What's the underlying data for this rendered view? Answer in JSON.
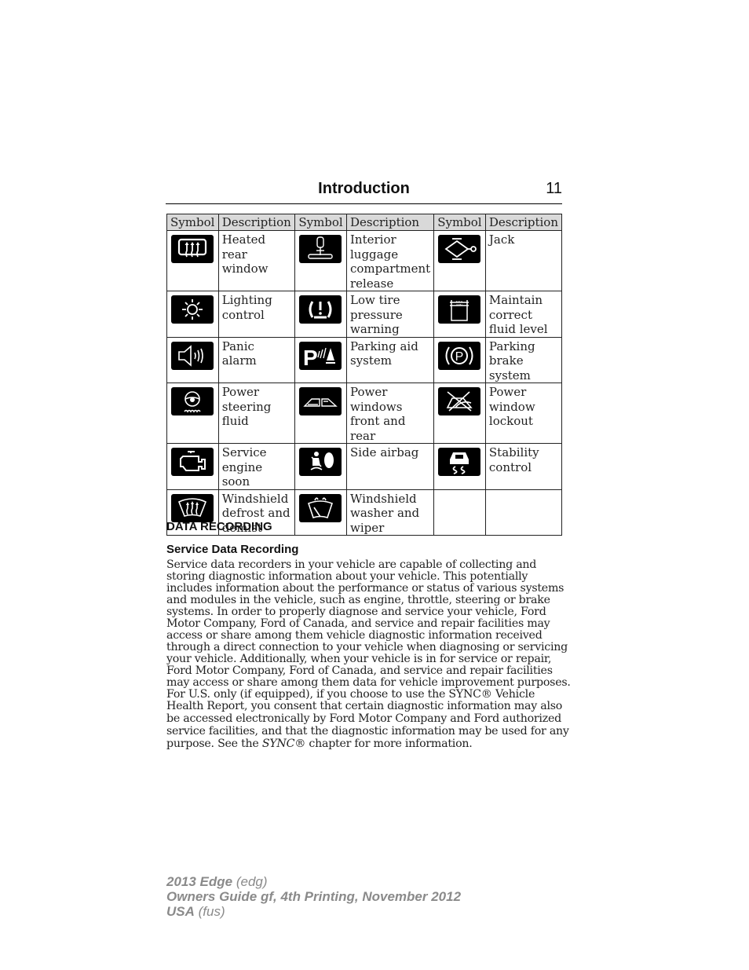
{
  "header": {
    "title": "Introduction",
    "page_number": "11"
  },
  "symbol_table": {
    "columns": [
      "Symbol",
      "Description",
      "Symbol",
      "Description",
      "Symbol",
      "Description"
    ],
    "rows": [
      [
        {
          "icon": "heated-rear-window-icon",
          "description": "Heated rear window"
        },
        {
          "icon": "interior-luggage-release-icon",
          "description": "Interior luggage compartment release"
        },
        {
          "icon": "jack-icon",
          "description": "Jack"
        }
      ],
      [
        {
          "icon": "lighting-control-icon",
          "description": "Lighting control"
        },
        {
          "icon": "low-tire-pressure-icon",
          "description": "Low tire pressure warning"
        },
        {
          "icon": "fluid-level-icon",
          "description": "Maintain correct fluid level"
        }
      ],
      [
        {
          "icon": "panic-alarm-icon",
          "description": "Panic alarm"
        },
        {
          "icon": "parking-aid-icon",
          "description": "Parking aid system"
        },
        {
          "icon": "parking-brake-icon",
          "description": "Parking brake system"
        }
      ],
      [
        {
          "icon": "power-steering-fluid-icon",
          "description": "Power steering fluid"
        },
        {
          "icon": "power-windows-icon",
          "description": "Power windows front and rear"
        },
        {
          "icon": "window-lockout-icon",
          "description": "Power window lockout"
        }
      ],
      [
        {
          "icon": "service-engine-icon",
          "description": "Service engine soon"
        },
        {
          "icon": "side-airbag-icon",
          "description": "Side airbag"
        },
        {
          "icon": "stability-control-icon",
          "description": "Stability control"
        }
      ],
      [
        {
          "icon": "windshield-defrost-icon",
          "description": "Windshield defrost and demist"
        },
        {
          "icon": "windshield-washer-icon",
          "description": "Windshield washer and wiper"
        },
        {
          "icon": "",
          "description": ""
        }
      ]
    ],
    "fluid_icon_labels": {
      "max": "MAX",
      "min": "MIN"
    },
    "parking_letter": "P"
  },
  "section": {
    "heading": "DATA RECORDING",
    "subheading": "Service Data Recording",
    "lines": [
      "Service data recorders in your vehicle are capable of collecting and",
      "storing diagnostic information about your vehicle. This potentially",
      "includes information about the performance or status of various systems",
      "and modules in the vehicle, such as engine, throttle, steering or brake",
      "systems. In order to properly diagnose and service your vehicle, Ford",
      "Motor Company, Ford of Canada, and service and repair facilities may",
      "access or share among them vehicle diagnostic information received",
      "through a direct connection to your vehicle when diagnosing or servicing",
      "your vehicle. Additionally, when your vehicle is in for service or repair,",
      "Ford Motor Company, Ford of Canada, and service and repair facilities",
      "may access or share among them data for vehicle improvement purposes.",
      "For U.S. only (if equipped), if you choose to use the SYNC® Vehicle",
      "Health Report, you consent that certain diagnostic information may also",
      "be accessed electronically by Ford Motor Company and Ford authorized",
      "service facilities, and that the diagnostic information may be used for any"
    ],
    "last_line": {
      "before": "purpose. See the ",
      "italic": "SYNC",
      "after": "® chapter for more information."
    }
  },
  "footer": {
    "line1": {
      "bold": "2013 Edge",
      "normal": " (edg)"
    },
    "line2": {
      "bold": "Owners Guide gf, 4th Printing, November 2012"
    },
    "line3": {
      "bold": "USA",
      "normal": " (fus)"
    }
  }
}
